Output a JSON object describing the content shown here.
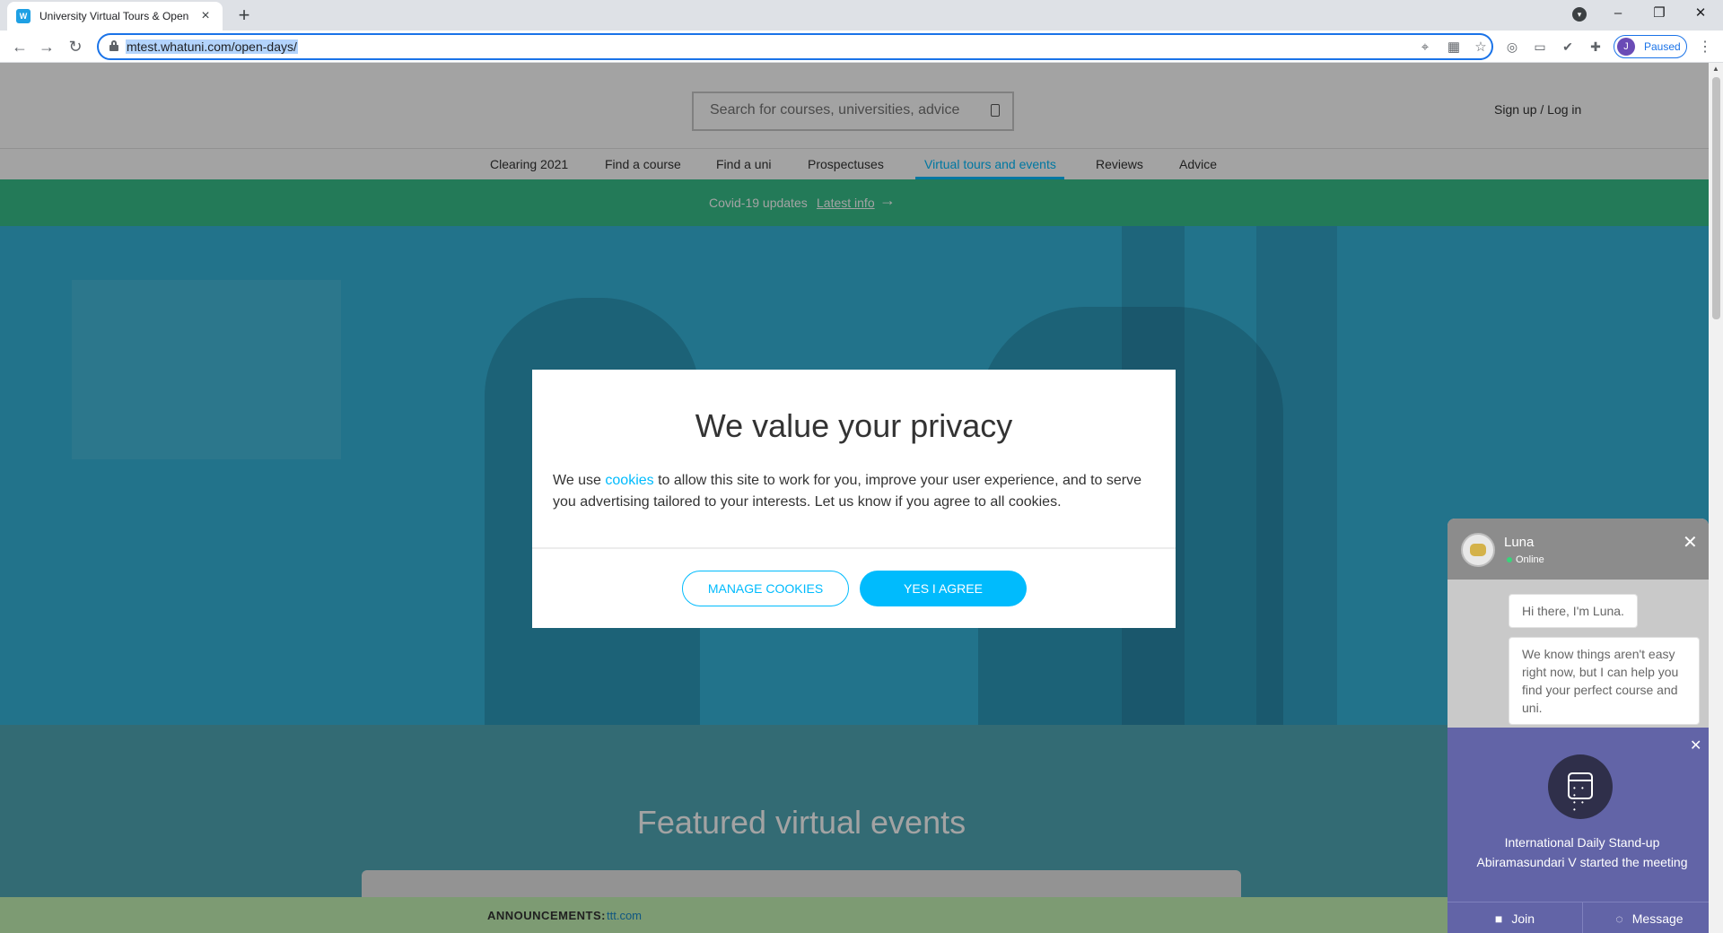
{
  "browser": {
    "tab_title": "University Virtual Tours & Open Days",
    "favicon_text": "W",
    "url": "mtest.whatuni.com/open-days/",
    "profile_initial": "J",
    "profile_status": "Paused"
  },
  "site": {
    "search_placeholder": "Search for courses, universities, advice",
    "signup_label": "Sign up / Log in",
    "nav": [
      {
        "label": "Clearing 2021"
      },
      {
        "label": "Find a course"
      },
      {
        "label": "Find a uni"
      },
      {
        "label": "Prospectuses"
      },
      {
        "label": "Virtual tours and events",
        "active": true
      },
      {
        "label": "Reviews"
      },
      {
        "label": "Advice"
      }
    ],
    "covid_text": "Covid-19 updates",
    "covid_link": "Latest info",
    "featured_heading": "Featured virtual events",
    "announcements_label": "ANNOUNCEMENTS:",
    "announcements_value": "ttt.com"
  },
  "modal": {
    "title": "We value your privacy",
    "body_before": "We use ",
    "body_link": "cookies",
    "body_after": " to allow this site to work for you, improve your user experience, and to serve you advertising tailored to your interests. Let us know if you agree to all cookies.",
    "manage_label": "MANAGE COOKIES",
    "agree_label": "YES I AGREE"
  },
  "chat": {
    "name": "Luna",
    "status": "Online",
    "messages": [
      "Hi there, I'm Luna.",
      "We know things aren't easy right now, but I can help you find your perfect course and uni."
    ]
  },
  "notification": {
    "title": "International Daily Stand-up",
    "subtitle": "Abiramasundari V started the meeting",
    "join_label": "Join",
    "message_label": "Message"
  },
  "colors": {
    "accent": "#00bbfd",
    "covid_bar": "#37bf8a",
    "teams": "#6264a7"
  }
}
